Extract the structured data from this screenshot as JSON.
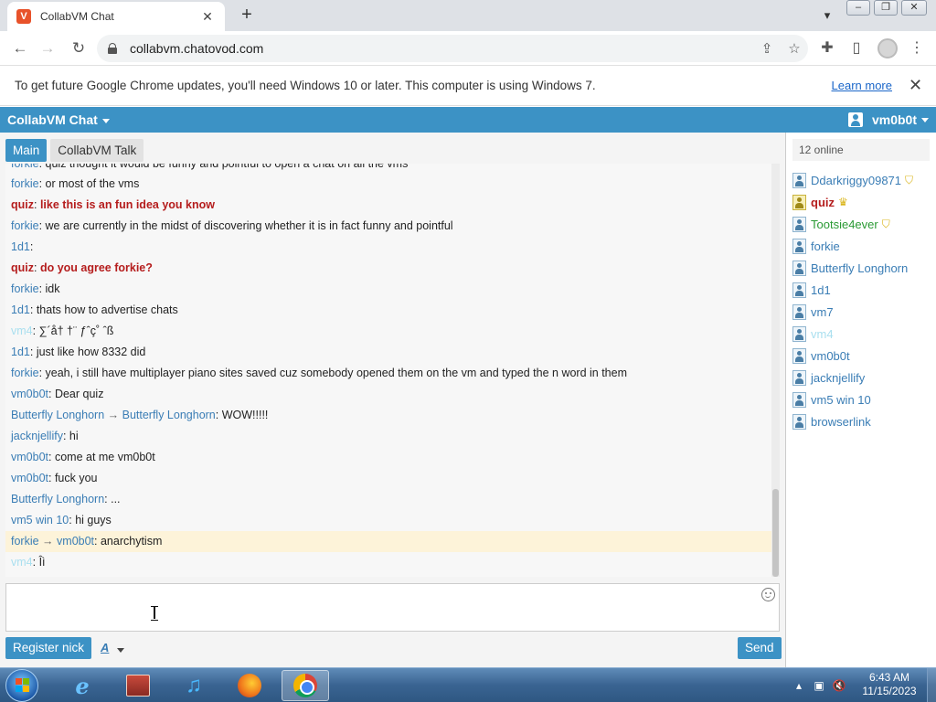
{
  "browser": {
    "tab_title": "CollabVM Chat",
    "tab_favicon": "V",
    "url": "collabvm.chatovod.com",
    "new_tab_symbol": "+",
    "tab_close_symbol": "✕"
  },
  "infobar": {
    "message": "To get future Google Chrome updates, you'll need Windows 10 or later. This computer is using Windows 7.",
    "link": "Learn more",
    "close_symbol": "✕"
  },
  "app": {
    "title": "CollabVM Chat",
    "username": "vm0b0t"
  },
  "rooms": [
    {
      "label": "Main"
    },
    {
      "label": "CollabVM Talk"
    }
  ],
  "messages": [
    {
      "nick": "forkie",
      "text": "quiz thought it would be funny and pointful to open a chat on all the vms"
    },
    {
      "nick": "forkie",
      "text": "or most of the vms"
    },
    {
      "nick": "quiz",
      "text": "like this is an fun idea you know"
    },
    {
      "nick": "forkie",
      "text": "we are currently in the midst of discovering whether it is in fact funny and pointful"
    },
    {
      "nick": "1d1",
      "text": ""
    },
    {
      "nick": "quiz",
      "text": "do you agree forkie?"
    },
    {
      "nick": "forkie",
      "text": "idk"
    },
    {
      "nick": "1d1",
      "text": "thats how to advertise chats"
    },
    {
      "nick": "vm4",
      "text": "∑´å† †¨ ƒˆç˚ ˆß"
    },
    {
      "nick": "1d1",
      "text": "just like how 8332 did"
    },
    {
      "nick": "forkie",
      "text": "yeah, i still have multiplayer piano sites saved cuz somebody opened them on the vm and typed the n word in them"
    },
    {
      "nick": "vm0b0t",
      "text": "Dear quiz"
    },
    {
      "nick": "Butterfly Longhorn",
      "to": "Butterfly Longhorn",
      "text": "WOW!!!!!"
    },
    {
      "nick": "jacknjellify",
      "text": "hi"
    },
    {
      "nick": "vm0b0t",
      "text": "come at me vm0b0t"
    },
    {
      "nick": "vm0b0t",
      "text": "fuck you"
    },
    {
      "nick": "Butterfly Longhorn",
      "text": "..."
    },
    {
      "nick": "vm5 win 10",
      "text": "hi guys"
    },
    {
      "nick": "forkie",
      "to": "vm0b0t",
      "text": "anarchytism"
    },
    {
      "nick": "vm4",
      "text": "Îì"
    }
  ],
  "compose": {
    "register_label": "Register nick",
    "font_label": "A",
    "send_label": "Send"
  },
  "userlist": {
    "online_label": "12 online",
    "users": [
      {
        "name": "Ddarkriggy09871",
        "badge": "shield-icon"
      },
      {
        "name": "quiz",
        "badge": "crown-icon"
      },
      {
        "name": "Tootsie4ever",
        "badge": "shield-icon"
      },
      {
        "name": "forkie"
      },
      {
        "name": "Butterfly Longhorn"
      },
      {
        "name": "1d1"
      },
      {
        "name": "vm7"
      },
      {
        "name": "vm4"
      },
      {
        "name": "vm0b0t"
      },
      {
        "name": "jacknjellify"
      },
      {
        "name": "vm5 win 10"
      },
      {
        "name": "browserlink"
      }
    ]
  },
  "taskbar": {
    "time": "6:43 AM",
    "date": "11/15/2023",
    "ie_glyph": "e",
    "music_glyph": "♫"
  },
  "colors": {
    "accent": "#3c92c5",
    "admin_nick": "#b51d1d",
    "mod_nick": "#2a9a34",
    "ghost_nick": "#a9dfef",
    "nick": "#3a7db5",
    "pm_highlight": "#fdf3d9"
  }
}
